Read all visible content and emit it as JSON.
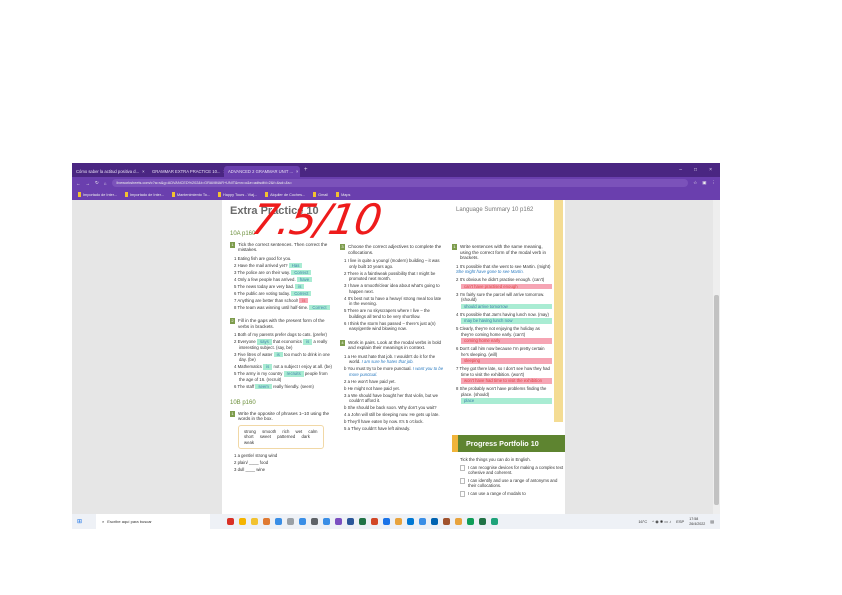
{
  "browser": {
    "tabs": [
      {
        "label": "Cómo saber la actitud positiva d..."
      },
      {
        "label": "GRAMMAR EXTRA PRACTICE 10..."
      },
      {
        "label": "ADVANCED 2 GRAMMAR UNIT ..."
      }
    ],
    "new_tab": "+",
    "url": "liveworksheets.com/c?a=s&g=ADVANCED%202&t=GRAMMAR+UNIT&mn=o&e=adtsdfd=2&f=&sd=&s=",
    "bookmarks": [
      "Importado de Inter...",
      "Importado de Inter...",
      "Mantenimiento To...",
      "Happy Tours - Viaj...",
      "Alquiler de Coches...",
      "Gmail",
      "Maps"
    ]
  },
  "grade": "7.5/10",
  "page": {
    "title": "Extra Practice 10",
    "lang_summary": "Language Summary 10 p162",
    "sec10a": "10A p160",
    "ex1_title": "Tick the correct sentences. Then correct the mistakes.",
    "ex1_items": [
      {
        "n": "1",
        "text": "Eating fish are good for you.",
        "ans": ""
      },
      {
        "n": "2",
        "text": "Have the mail arrived yet?",
        "ans": "Has"
      },
      {
        "n": "3",
        "text": "The police are on their way.",
        "ans": "Correct"
      },
      {
        "n": "4",
        "text": "Only a few people has arrived.",
        "ans": "have"
      },
      {
        "n": "5",
        "text": "The news today are very bad.",
        "ans": "is"
      },
      {
        "n": "6",
        "text": "The public are voting today.",
        "ans": "Correct"
      },
      {
        "n": "7",
        "text": "Anything are better than school!",
        "ans": "is",
        "wrong": true
      },
      {
        "n": "8",
        "text": "The team was winning until half-time.",
        "ans": "Correct"
      }
    ],
    "ex2_title": "Fill in the gaps with the present form of the verbs in brackets.",
    "ex2_items": [
      {
        "n": "1",
        "text": "Both of my parents prefer dogs to cats. (prefer)"
      },
      {
        "n": "2",
        "a": "Everyone",
        "ans": "says",
        "b": "that economics",
        "ans2": "is",
        "c": "a really interesting subject. (say, be)"
      },
      {
        "n": "3",
        "a": "Five litres of water",
        "ans": "is",
        "b": "too much to drink in one day. (be)"
      },
      {
        "n": "4",
        "a": "Mathematics",
        "ans": "is",
        "b": "not a subject I enjoy at all. (be)"
      },
      {
        "n": "5",
        "a": "The army in my country",
        "ans": "recruits",
        "b": "people from the age of 16. (recruit)"
      },
      {
        "n": "6",
        "a": "The staff",
        "ans": "seem",
        "b": "really friendly. (seem)"
      }
    ],
    "sec10b": "10B p160",
    "ex3_title": "Write the opposite of phrases 1–10 using the words in the box.",
    "box_words": "strong smooth rich wet calm short sweet patterned dark weak",
    "ex3_items": [
      "1 a gentle/ strong wind",
      "2 plain/ ____ food",
      "3 dull ____ wine"
    ],
    "ex4_title": "Choose the correct adjectives to complete the collocations.",
    "ex4_items": [
      "1 I live in quite a young/ (modern) building – it was only built 10 years ago.",
      "2 There is a faint/weak possibility that I might be promoted next month.",
      "3 I have a smooth/clear idea about what's going to happen next.",
      "4 It's best not to have a heavy/ strong meal too late in the evening.",
      "5 There are no skyscrapers where I live – the buildings all tend to be very short/low.",
      "6 I think the storm has passed – there's just a(n) easy/gentle wind blowing now."
    ],
    "ex5_title": "Work in pairs. Look at the modal verbs in bold and explain their meanings in context.",
    "ex5_items": [
      {
        "text": "1 a He must hate that job. I wouldn't do it for the world.",
        "ans": "I am sure he hates that job."
      },
      {
        "text": "b You must try to be more punctual.",
        "ans": "I want you to be more punctual."
      },
      {
        "text": "2 a He won't have paid yet.",
        "ans": ""
      },
      {
        "text": "b He might not have paid yet.",
        "ans": ""
      },
      {
        "text": "3 a We should have bought her that violin, but we couldn't afford it.",
        "ans": ""
      },
      {
        "text": "b She should be back soon. Why don't you wait?",
        "ans": ""
      },
      {
        "text": "4 a John will still be sleeping now. He gets up late.",
        "ans": ""
      },
      {
        "text": "b They'll have eaten by now. It's 5 o'clock.",
        "ans": ""
      },
      {
        "text": "5 a They couldn't have left already.",
        "ans": ""
      }
    ],
    "ex6_title": "Write sentences with the same meaning, using the correct form of the modal verb in brackets.",
    "ex6_items": [
      {
        "text": "1 It's possible that she went to see Martin. (might)",
        "ans": "She might have gone to see Martin.",
        "kind": "example"
      },
      {
        "text": "2 It's obvious he didn't practise enough. (can't)",
        "ans": "can't have practised enough",
        "kind": "bad"
      },
      {
        "text": "3 I'm fairly sure the parcel will arrive tomorrow. (should)",
        "ans": "should arrive tomorrow",
        "kind": "good"
      },
      {
        "text": "4 It's possible that Jan's having lunch now. (may)",
        "ans": "may be having lunch now",
        "kind": "good"
      },
      {
        "text": "5 Clearly, they're not enjoying the holiday as they're coming home early. (can't)",
        "ans": "coming home early",
        "kind": "bad"
      },
      {
        "text": "6 Don't call him now because I'm pretty certain he's sleeping. (will)",
        "ans": "sleeping",
        "kind": "bad"
      },
      {
        "text": "7 They got there late, so I don't see how they had time to visit the exhibition. (won't)",
        "ans": "won't have had time to visit the exhibition",
        "kind": "bad"
      },
      {
        "text": "8 She probably won't have problems finding the place. (should)",
        "ans": "place",
        "kind": "good"
      }
    ],
    "portfolio": {
      "title": "Progress Portfolio 10",
      "intro": "Tick the things you can do in English.",
      "items": [
        "I can recognise devices for making a complex text cohesive and coherent.",
        "I can identify and use a range of antonyms and their collocations.",
        "I can use a range of modals to"
      ]
    }
  },
  "taskbar": {
    "search_placeholder": "Escribe aquí para buscar",
    "temp": "16°C",
    "lang": "ESP",
    "time": "17:58",
    "date": "26/4/2022"
  },
  "colors": {
    "accent": "#6a3fae",
    "green": "#a9ecd3",
    "red": "#f6a5b4",
    "grade": "#ee1b1b"
  }
}
